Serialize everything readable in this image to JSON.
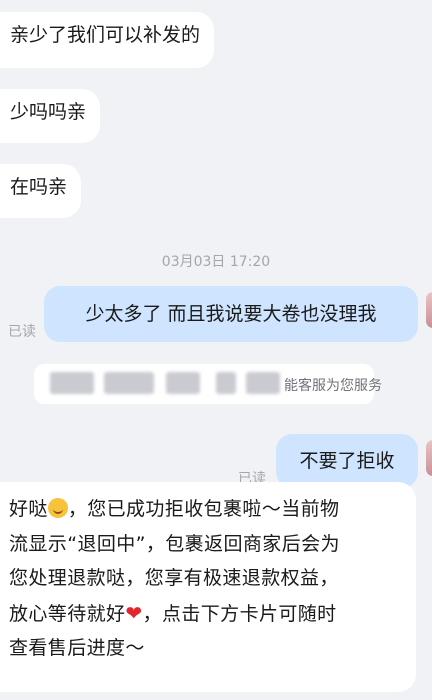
{
  "messages": {
    "m1": "亲少了我们可以补发的",
    "m2": "少吗吗亲",
    "m3": "在吗亲",
    "timestamp": "03月03日 17:20",
    "m4": "少太多了 而且我说要大卷也没理我",
    "m4_status": "已读",
    "notice_text": "能客服为您服务",
    "m5": "不要了拒收",
    "m5_status": "已读",
    "long": {
      "line1_a": "好哒",
      "line1_b": "，您已成功拒收包裹啦～当前物",
      "line2": "流显示“退回中”，包裹返回商家后会为",
      "line3": "您处理退款哒，您享有极速退款权益，",
      "line4_a": "放心等待就好",
      "line4_b": "，点击下方卡片可随时",
      "line5": "查看售后进度～"
    }
  },
  "icons": {
    "smile": "smile-emoji-icon",
    "heart": "red-heart-icon"
  },
  "colors": {
    "background": "#f1f2f6",
    "outgoing_bubble": "#cfe5ff",
    "incoming_bubble": "#ffffff"
  }
}
